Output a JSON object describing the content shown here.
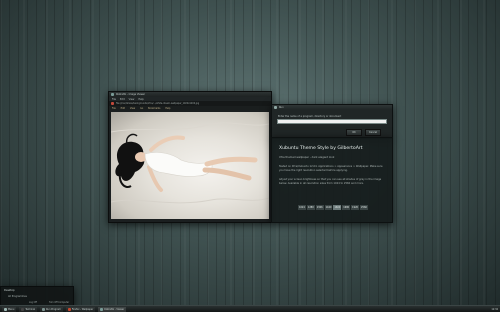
{
  "viewer": {
    "title": "Ristretto - Image Viewer",
    "menu": [
      "File",
      "Edit",
      "View",
      "Help"
    ],
    "path": "file:///usr/share/backgrounds/xfce/.../white-dream-wallpaper_1920x1200.jpg",
    "menu2": [
      "File",
      "Edit",
      "View",
      "Go",
      "Bookmarks",
      "Help"
    ]
  },
  "dialog": {
    "title": "Run",
    "label": "Enter the name of a program, directory or document",
    "input_value": "",
    "ok_label": "OK",
    "cancel_label": "Cancel"
  },
  "info": {
    "heading": "Xubuntu Theme Style by GilbertoArt",
    "subheading": "Xfce themed wallpaper - dark elegant look",
    "paragraph1": "Tested on Xfce/Xubuntu 12.04. Applications > Appearance > Wallpaper. Make sure you have the right resolution selected before applying.",
    "paragraph2": "Adjust your screen brightness so that you can see all shades of gray in the image below. Available in all resolution sizes from 1024 to 2560 and more.",
    "resolutions": [
      "1024",
      "1280",
      "1366",
      "1440",
      "1600",
      "1680",
      "1920",
      "2560"
    ],
    "selected_resolution": "1600"
  },
  "startmenu": {
    "title": "Desktop",
    "item": "All Programmes",
    "opt1": "Log Off",
    "opt2": "Turn Off Computer"
  },
  "taskbar": {
    "start_label": "Menu",
    "tasks": [
      "Terminal",
      "Run Program",
      "Firefox - Wallpaper",
      "Ristretto - Viewer"
    ],
    "clock": "12:34"
  }
}
